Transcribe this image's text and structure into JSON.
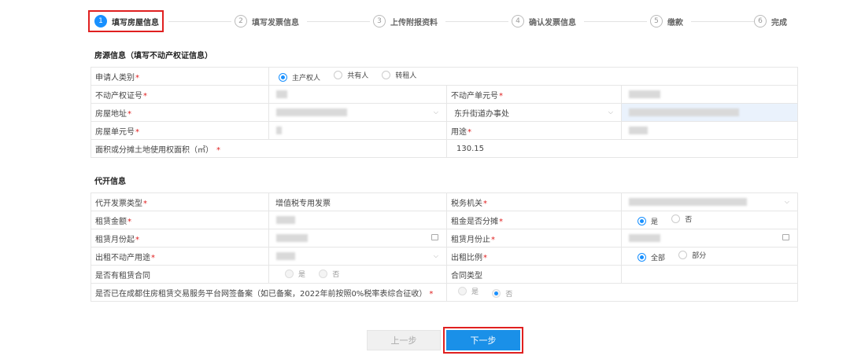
{
  "steps": [
    {
      "num": "1",
      "label": "填写房屋信息"
    },
    {
      "num": "2",
      "label": "填写发票信息"
    },
    {
      "num": "3",
      "label": "上传附报资料"
    },
    {
      "num": "4",
      "label": "确认发票信息"
    },
    {
      "num": "5",
      "label": "缴款"
    },
    {
      "num": "6",
      "label": "完成"
    }
  ],
  "house": {
    "title": "房源信息（填写不动产权证信息）",
    "applicant_type_label": "申请人类别",
    "applicant_options": [
      "主产权人",
      "共有人",
      "转租人"
    ],
    "cert_no_label": "不动产权证号",
    "unit_no_label": "不动产单元号",
    "address_label": "房屋地址",
    "office_value": "东升街道办事处",
    "room_unit_label": "房屋单元号",
    "usage_label": "用途",
    "area_label": "面积或分摊土地使用权面积（㎡）",
    "area_value": "130.15"
  },
  "invoice": {
    "title": "代开信息",
    "invoice_type_label": "代开发票类型",
    "invoice_type_value": "增值税专用发票",
    "tax_office_label": "税务机关",
    "rent_amount_label": "租赁金额",
    "rent_split_label": "租金是否分摊",
    "yes_no": [
      "是",
      "否"
    ],
    "start_label": "租赁月份起",
    "end_label": "租赁月份止",
    "rent_use_label": "出租不动产用途",
    "ratio_label": "出租比例",
    "ratio_options": [
      "全部",
      "部分"
    ],
    "contract_label": "是否有租赁合同",
    "contract_type_label": "合同类型",
    "filed_label": "是否已在成都住房租赁交易服务平台网签备案（如已备案，2022年前按照0%税率表综合征收）"
  },
  "buttons": {
    "prev": "上一步",
    "next": "下一步"
  },
  "required_mark": "*",
  "colors": {
    "accent": "#1890ff",
    "highlight": "#e02020"
  }
}
